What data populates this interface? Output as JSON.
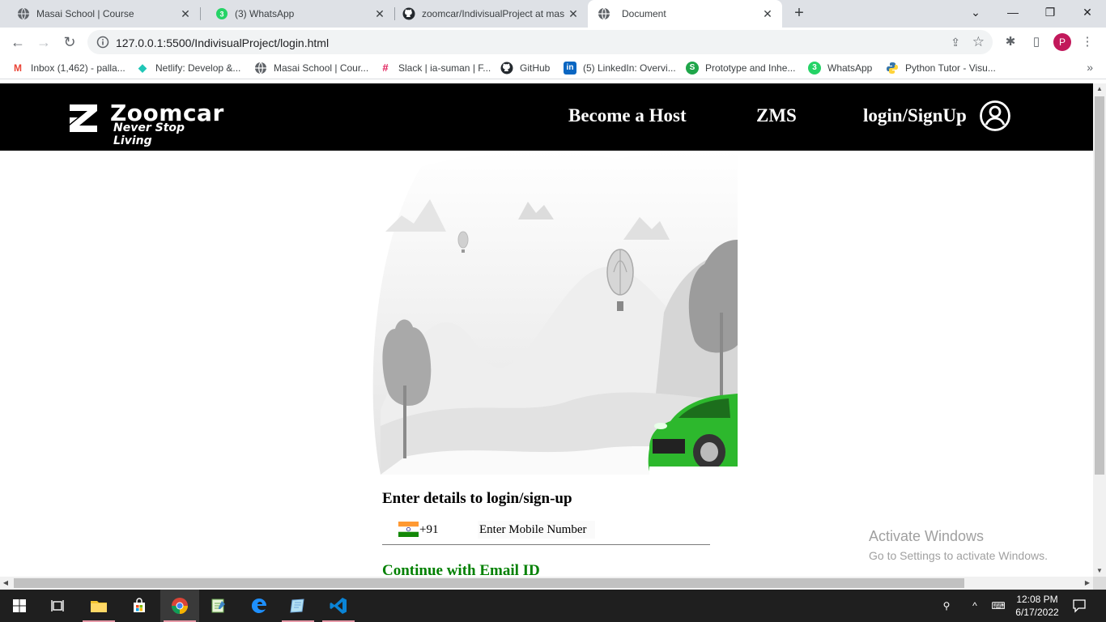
{
  "browser": {
    "tabs": [
      {
        "title": "Masai School | Course",
        "icon": "globe-icon"
      },
      {
        "title": "(3) WhatsApp",
        "icon": "whatsapp-icon"
      },
      {
        "title": "zoomcar/IndivisualProject at mas",
        "icon": "github-icon"
      },
      {
        "title": "Document",
        "icon": "globe-icon"
      }
    ],
    "active_tab": 3,
    "url": "127.0.0.1:5500/IndivisualProject/login.html",
    "profile_initial": "P",
    "bookmarks": [
      {
        "label": "Inbox (1,462) - palla...",
        "icon": "gmail-icon"
      },
      {
        "label": "Netlify: Develop &...",
        "icon": "netlify-icon"
      },
      {
        "label": "Masai School | Cour...",
        "icon": "globe-icon"
      },
      {
        "label": "Slack | ia-suman | F...",
        "icon": "slack-icon"
      },
      {
        "label": "GitHub",
        "icon": "github-icon"
      },
      {
        "label": "(5) LinkedIn: Overvi...",
        "icon": "linkedin-icon"
      },
      {
        "label": "Prototype and Inhe...",
        "icon": "s-green-icon"
      },
      {
        "label": "WhatsApp",
        "icon": "whatsapp-icon"
      },
      {
        "label": "Python Tutor - Visu...",
        "icon": "python-icon"
      }
    ]
  },
  "site": {
    "brand": "Zoomcar",
    "tagline": "Never Stop Living",
    "nav": {
      "host": "Become a Host",
      "zms": "ZMS",
      "login": "login/SignUp"
    },
    "login": {
      "heading": "Enter details to login/sign-up",
      "country_code": "+91",
      "mobile_placeholder": "Enter Mobile Number",
      "email_link": "Continue with Email ID"
    }
  },
  "watermark": {
    "line1": "Activate Windows",
    "line2": "Go to Settings to activate Windows."
  },
  "taskbar": {
    "time": "12:08 PM",
    "date": "6/17/2022"
  },
  "colors": {
    "header_bg": "#000000",
    "email_link": "#008000",
    "car_green": "#2db82d"
  }
}
